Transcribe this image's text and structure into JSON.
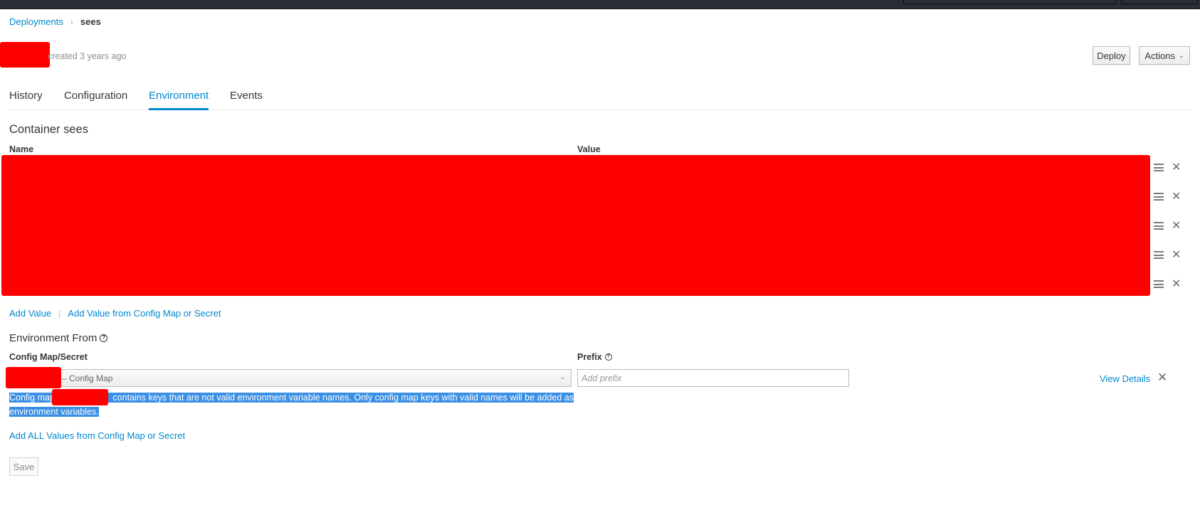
{
  "breadcrumb": {
    "parent": "Deployments",
    "separator": "›",
    "current": "sees"
  },
  "header": {
    "created_text": "created 3 years ago",
    "deploy_label": "Deploy",
    "actions_label": "Actions",
    "actions_icon": "chevron-down-icon"
  },
  "tabs": [
    {
      "label": "History",
      "active": false
    },
    {
      "label": "Configuration",
      "active": false
    },
    {
      "label": "Environment",
      "active": true
    },
    {
      "label": "Events",
      "active": false
    }
  ],
  "container": {
    "title": "Container sees",
    "columns": {
      "name": "Name",
      "value": "Value"
    },
    "env_rows_count": 5,
    "row_icons": {
      "drag": "drag-handle-icon",
      "delete": "close-icon"
    }
  },
  "add_links": {
    "add_value": "Add Value",
    "divider": "|",
    "add_from": "Add Value from Config Map or Secret"
  },
  "env_from": {
    "title": "Environment From",
    "config_map_label": "Config Map/Secret",
    "prefix_label": "Prefix",
    "selected_suffix": "– Config Map",
    "prefix_placeholder": "Add prefix",
    "prefix_value": "",
    "view_details": "View Details",
    "warning_prefix": "Config map",
    "warning_suffix": "contains keys that are not valid environment variable names. Only config map keys with valid names will be added as environment variables.",
    "add_all": "Add ALL Values from Config Map or Secret"
  },
  "footer": {
    "save_label": "Save"
  },
  "colors": {
    "accent": "#0088ce",
    "topbar": "#292e34",
    "selection": "#3b8fe4",
    "redaction": "#ff0000"
  }
}
